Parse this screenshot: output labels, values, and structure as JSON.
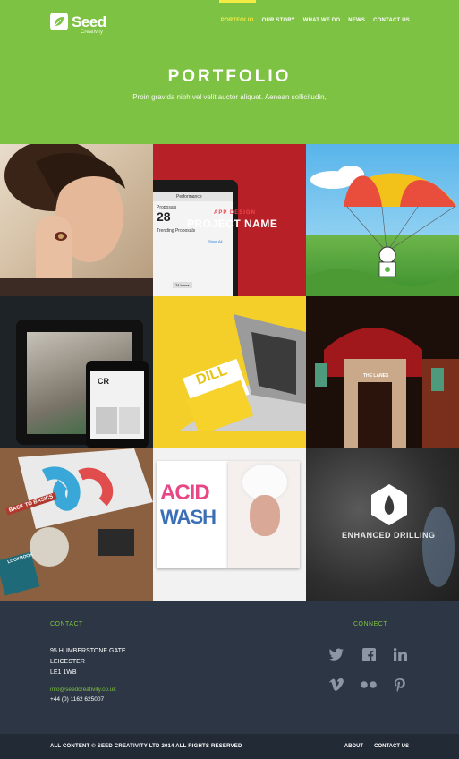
{
  "brand": {
    "name": "Seed",
    "tagline": "Creativity"
  },
  "nav": [
    {
      "label": "PORTFOLIO",
      "active": true
    },
    {
      "label": "OUR STORY"
    },
    {
      "label": "WHAT WE DO"
    },
    {
      "label": "NEWS"
    },
    {
      "label": "CONTACT US"
    }
  ],
  "hero": {
    "title": "PORTFOLIO",
    "subtitle": "Proin gravida nibh vel velit auctor aliquet. Aenean sollicitudin,"
  },
  "portfolio": {
    "t2": {
      "kicker": "APP DESIGN",
      "title": "PROJECT NAME",
      "app_title": "Performance",
      "app_row1": "Proposals",
      "app_num": "28",
      "app_row2": "Trending Proposals",
      "app_show": "Show All",
      "app_hours": "74 hours"
    },
    "t4": {
      "logo": "CR"
    },
    "t5": {
      "word": "DILL"
    },
    "t6": {
      "sign": "THE LANES"
    },
    "t7": {
      "text1": "BACK TO BASICS",
      "text2": "LOOKBOOK"
    },
    "t8": {
      "word1": "ACID",
      "word2": "WASH"
    },
    "t9": {
      "title": "ENHANCED DRILLING"
    }
  },
  "footer": {
    "contact_heading": "CONTACT",
    "address": [
      "95 HUMBERSTONE GATE",
      "LEICESTER",
      "LE1 1WB"
    ],
    "email": "info@seedcreativity.co.uk",
    "phone": "+44 (0) 1162 625007",
    "connect_heading": "CONNECT",
    "social_icons": [
      "twitter-icon",
      "facebook-icon",
      "linkedin-icon",
      "vimeo-icon",
      "flickr-icon",
      "pinterest-icon"
    ],
    "copyright": "ALL CONTENT © SEED CREATIVITY LTD 2014 ALL RIGHTS RESERVED",
    "links": [
      "ABOUT",
      "CONTACT US"
    ]
  },
  "colors": {
    "brand_green": "#7dc242",
    "nav_active": "#f4ec45",
    "footer_bg": "#2c3644",
    "bottom_bar": "#222a35"
  }
}
